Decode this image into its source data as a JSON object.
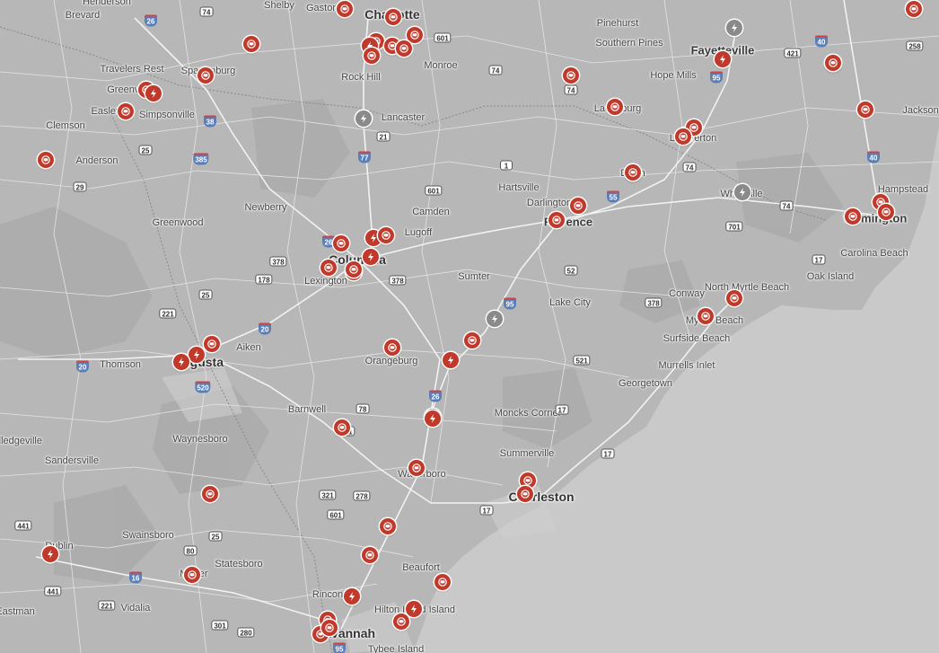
{
  "colors": {
    "land": "#b5b5b5",
    "water": "#c9c9c9",
    "marker": "#c0392b",
    "marker_inactive": "#8a8a8a",
    "road": "#ffffff"
  },
  "labels": [
    {
      "text": "Charlotte",
      "cls": "city"
    },
    {
      "text": "Fayetteville",
      "cls": "big"
    },
    {
      "text": "Columbia",
      "cls": "city"
    },
    {
      "text": "Augusta",
      "cls": "city"
    },
    {
      "text": "Charleston",
      "cls": "city"
    },
    {
      "text": "Savannah",
      "cls": "city"
    },
    {
      "text": "Wilmington",
      "cls": "big"
    },
    {
      "text": "Florence",
      "cls": "big"
    },
    {
      "text": "Brevard"
    },
    {
      "text": "Shelby"
    },
    {
      "text": "Gastonia"
    },
    {
      "text": "Pinehurst"
    },
    {
      "text": "Southern Pines"
    },
    {
      "text": "Travelers Rest"
    },
    {
      "text": "Spartanburg"
    },
    {
      "text": "Greenville"
    },
    {
      "text": "Easley"
    },
    {
      "text": "Simpsonville"
    },
    {
      "text": "Clemson"
    },
    {
      "text": "Anderson"
    },
    {
      "text": "Rock Hill"
    },
    {
      "text": "Monroe"
    },
    {
      "text": "Hope Mills"
    },
    {
      "text": "Lancaster"
    },
    {
      "text": "Laurinburg"
    },
    {
      "text": "Lumberton"
    },
    {
      "text": "Hartsville"
    },
    {
      "text": "Darlington"
    },
    {
      "text": "Dillon"
    },
    {
      "text": "Whiteville"
    },
    {
      "text": "Hampstead"
    },
    {
      "text": "Newberry"
    },
    {
      "text": "Camden"
    },
    {
      "text": "Lugoff"
    },
    {
      "text": "Greenwood"
    },
    {
      "text": "Lexington"
    },
    {
      "text": "Sumter"
    },
    {
      "text": "Lake City"
    },
    {
      "text": "Conway"
    },
    {
      "text": "North Myrtle Beach"
    },
    {
      "text": "Myrtle Beach"
    },
    {
      "text": "Surfside Beach"
    },
    {
      "text": "Murrells Inlet"
    },
    {
      "text": "Carolina Beach"
    },
    {
      "text": "Oak Island"
    },
    {
      "text": "Aiken"
    },
    {
      "text": "Thomson"
    },
    {
      "text": "Orangeburg"
    },
    {
      "text": "Georgetown"
    },
    {
      "text": "Moncks Corner"
    },
    {
      "text": "Barnwell"
    },
    {
      "text": "Waynesboro"
    },
    {
      "text": "Summerville"
    },
    {
      "text": "Walterboro"
    },
    {
      "text": "Sandersville"
    },
    {
      "text": "Swainsboro"
    },
    {
      "text": "Statesboro"
    },
    {
      "text": "Dublin"
    },
    {
      "text": "Metter"
    },
    {
      "text": "Beaufort"
    },
    {
      "text": "Rincon"
    },
    {
      "text": "Hilton Head Island"
    },
    {
      "text": "Vidalia"
    },
    {
      "text": "Tybee Island"
    },
    {
      "text": "Milledgeville"
    },
    {
      "text": "Eastman"
    },
    {
      "text": "Jacksonville"
    },
    {
      "text": "Henderson"
    }
  ],
  "shields": [
    {
      "text": "26",
      "type": "i"
    },
    {
      "text": "74",
      "type": "us"
    },
    {
      "text": "601",
      "type": "us"
    },
    {
      "text": "74",
      "type": "us"
    },
    {
      "text": "40",
      "type": "i"
    },
    {
      "text": "421",
      "type": "us"
    },
    {
      "text": "258",
      "type": "us"
    },
    {
      "text": "95",
      "type": "i"
    },
    {
      "text": "74",
      "type": "us"
    },
    {
      "text": "38",
      "type": "i"
    },
    {
      "text": "21",
      "type": "us"
    },
    {
      "text": "25",
      "type": "us"
    },
    {
      "text": "385",
      "type": "i"
    },
    {
      "text": "77",
      "type": "i"
    },
    {
      "text": "1",
      "type": "us"
    },
    {
      "text": "74",
      "type": "us"
    },
    {
      "text": "40",
      "type": "i"
    },
    {
      "text": "29",
      "type": "us"
    },
    {
      "text": "601",
      "type": "us"
    },
    {
      "text": "55",
      "type": "i"
    },
    {
      "text": "74",
      "type": "us"
    },
    {
      "text": "701",
      "type": "us"
    },
    {
      "text": "17",
      "type": "us"
    },
    {
      "text": "26",
      "type": "i"
    },
    {
      "text": "378",
      "type": "us"
    },
    {
      "text": "178",
      "type": "us"
    },
    {
      "text": "378",
      "type": "us"
    },
    {
      "text": "52",
      "type": "us"
    },
    {
      "text": "95",
      "type": "i"
    },
    {
      "text": "378",
      "type": "us"
    },
    {
      "text": "25",
      "type": "us"
    },
    {
      "text": "221",
      "type": "us"
    },
    {
      "text": "20",
      "type": "i"
    },
    {
      "text": "20",
      "type": "i"
    },
    {
      "text": "520",
      "type": "i"
    },
    {
      "text": "521",
      "type": "us"
    },
    {
      "text": "26",
      "type": "i"
    },
    {
      "text": "78",
      "type": "us"
    },
    {
      "text": "17",
      "type": "us"
    },
    {
      "text": "301",
      "type": "us"
    },
    {
      "text": "17",
      "type": "us"
    },
    {
      "text": "321",
      "type": "us"
    },
    {
      "text": "601",
      "type": "us"
    },
    {
      "text": "278",
      "type": "us"
    },
    {
      "text": "17",
      "type": "us"
    },
    {
      "text": "441",
      "type": "us"
    },
    {
      "text": "80",
      "type": "us"
    },
    {
      "text": "25",
      "type": "us"
    },
    {
      "text": "16",
      "type": "i"
    },
    {
      "text": "441",
      "type": "us"
    },
    {
      "text": "221",
      "type": "us"
    },
    {
      "text": "301",
      "type": "us"
    },
    {
      "text": "280",
      "type": "us"
    },
    {
      "text": "95",
      "type": "i"
    }
  ],
  "markers": [
    {
      "type": "station"
    },
    {
      "type": "station"
    },
    {
      "type": "station"
    },
    {
      "type": "station"
    },
    {
      "type": "station"
    },
    {
      "type": "station"
    },
    {
      "type": "charger"
    },
    {
      "type": "station"
    },
    {
      "type": "station"
    },
    {
      "type": "station"
    },
    {
      "type": "station"
    },
    {
      "type": "station"
    },
    {
      "type": "charger"
    },
    {
      "type": "station"
    },
    {
      "type": "station"
    },
    {
      "type": "gray"
    },
    {
      "type": "station"
    },
    {
      "type": "charger"
    },
    {
      "type": "station"
    },
    {
      "type": "station"
    },
    {
      "type": "station"
    },
    {
      "type": "station"
    },
    {
      "type": "station"
    },
    {
      "type": "charger"
    },
    {
      "type": "station"
    },
    {
      "type": "station"
    },
    {
      "type": "station"
    },
    {
      "type": "charger"
    },
    {
      "type": "station"
    },
    {
      "type": "gray"
    },
    {
      "type": "station"
    },
    {
      "type": "charger"
    },
    {
      "type": "station"
    },
    {
      "type": "station"
    },
    {
      "type": "station"
    },
    {
      "type": "charger"
    },
    {
      "type": "charger"
    },
    {
      "type": "station"
    },
    {
      "type": "station"
    },
    {
      "type": "station"
    },
    {
      "type": "station"
    },
    {
      "type": "station"
    },
    {
      "type": "gray"
    },
    {
      "type": "station"
    },
    {
      "type": "charger"
    },
    {
      "type": "charger"
    },
    {
      "type": "charger"
    },
    {
      "type": "charger"
    },
    {
      "type": "station"
    },
    {
      "type": "station"
    },
    {
      "type": "charger"
    },
    {
      "type": "station"
    },
    {
      "type": "station"
    },
    {
      "type": "station"
    },
    {
      "type": "station"
    },
    {
      "type": "station"
    },
    {
      "type": "charger"
    },
    {
      "type": "station"
    },
    {
      "type": "station"
    },
    {
      "type": "station"
    },
    {
      "type": "station"
    },
    {
      "type": "charger"
    },
    {
      "type": "station"
    },
    {
      "type": "station"
    },
    {
      "type": "station"
    },
    {
      "type": "station"
    },
    {
      "type": "station"
    },
    {
      "type": "station"
    },
    {
      "type": "gray"
    },
    {
      "type": "charger"
    },
    {
      "type": "station"
    }
  ]
}
